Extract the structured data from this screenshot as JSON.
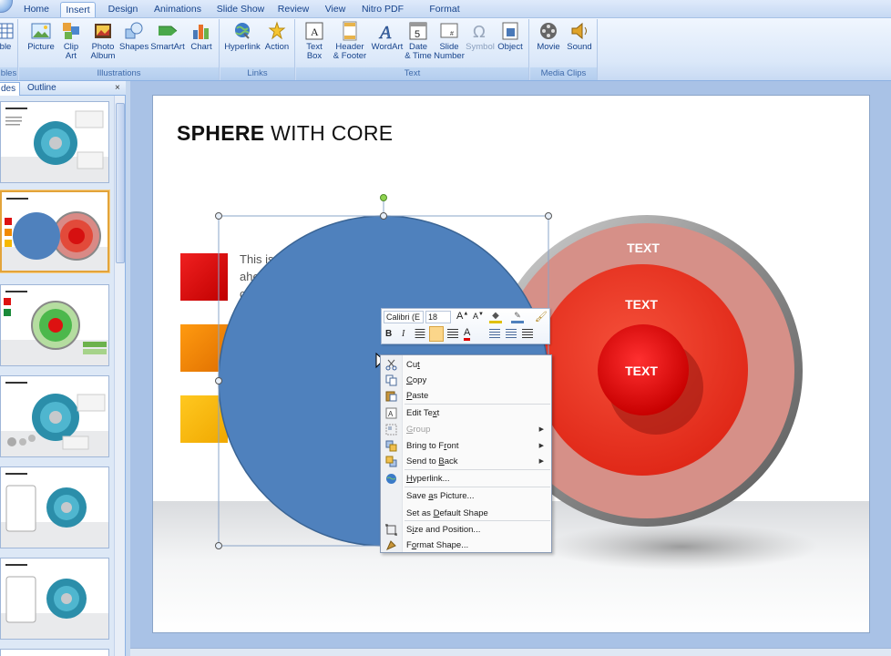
{
  "tabs": [
    "Home",
    "Insert",
    "Design",
    "Animations",
    "Slide Show",
    "Review",
    "View",
    "Nitro PDF",
    "Format"
  ],
  "active_tab": "Insert",
  "ribbon": {
    "groups": {
      "tables": "bles",
      "illustrations": "Illustrations",
      "links": "Links",
      "text": "Text",
      "media": "Media Clips"
    },
    "table_btn": "ble",
    "picture": "Picture",
    "clipart": [
      "Clip",
      "Art"
    ],
    "photo_album": [
      "Photo",
      "Album"
    ],
    "shapes": "Shapes",
    "smartart": "SmartArt",
    "chart": "Chart",
    "hyperlink": "Hyperlink",
    "action": "Action",
    "textbox": [
      "Text",
      "Box"
    ],
    "header_footer": [
      "Header",
      "& Footer"
    ],
    "wordart": "WordArt",
    "date_time": [
      "Date",
      "& Time"
    ],
    "slide_number": [
      "Slide",
      "Number"
    ],
    "symbol": "Symbol",
    "object": "Object",
    "movie": "Movie",
    "sound": "Sound"
  },
  "pane": {
    "tab_slides": "des",
    "tab_outline": "Outline",
    "close": "×"
  },
  "slide": {
    "title_bold": "SPHERE",
    "title_rest": " WITH CORE",
    "body_text": [
      "This is",
      "ahe",
      "c"
    ],
    "sphere_labels": [
      "TEXT",
      "TEXT",
      "TEXT"
    ]
  },
  "colors": {
    "blue_circle": "#4f81bd",
    "red_core": "#e01010",
    "square1": "#dd1111",
    "square2": "#f28a00",
    "square3": "#f6b800"
  },
  "mini_toolbar": {
    "font": "Calibri (E",
    "size": "18"
  },
  "context_menu": [
    {
      "label": "Cut",
      "icon": "scissors-icon",
      "enabled": true
    },
    {
      "label": "Copy",
      "icon": "copy-icon",
      "enabled": true
    },
    {
      "label": "Paste",
      "icon": "paste-icon",
      "enabled": true
    },
    {
      "label": "Edit Text",
      "icon": "edit-text-icon",
      "enabled": true
    },
    {
      "label": "Group",
      "icon": "group-icon",
      "enabled": false,
      "submenu": true
    },
    {
      "label": "Bring to Front",
      "icon": "bring-front-icon",
      "enabled": true,
      "submenu": true
    },
    {
      "label": "Send to Back",
      "icon": "send-back-icon",
      "enabled": true,
      "submenu": true
    },
    {
      "label": "Hyperlink...",
      "icon": "hyperlink-icon",
      "enabled": true
    },
    {
      "label": "Save as Picture...",
      "enabled": true
    },
    {
      "label": "Set as Default Shape",
      "enabled": true
    },
    {
      "label": "Size and Position...",
      "icon": "size-icon",
      "enabled": true
    },
    {
      "label": "Format Shape...",
      "icon": "format-shape-icon",
      "enabled": true
    }
  ]
}
